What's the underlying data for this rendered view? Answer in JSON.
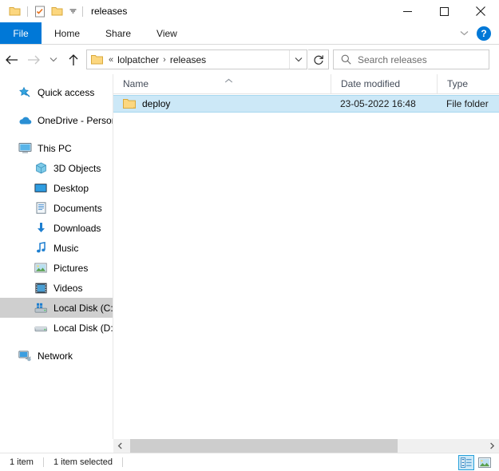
{
  "window": {
    "title": "releases",
    "quick_access_toolbar": [
      {
        "name": "pin-folder-icon",
        "tooltip": "Pin to Quick access"
      },
      {
        "name": "properties-icon",
        "tooltip": "Properties"
      },
      {
        "name": "new-folder-icon",
        "tooltip": "New folder"
      }
    ],
    "controls": {
      "minimize": "—",
      "maximize": "☐",
      "close": "✕"
    }
  },
  "ribbon": {
    "tabs": [
      {
        "label": "File",
        "active": true
      },
      {
        "label": "Home",
        "active": false
      },
      {
        "label": "Share",
        "active": false
      },
      {
        "label": "View",
        "active": false
      }
    ],
    "collapse_label": "∨",
    "help_label": "?"
  },
  "navigation": {
    "back_tooltip": "Back",
    "forward_tooltip": "Forward",
    "recent_tooltip": "Recent locations",
    "up_tooltip": "Up",
    "refresh_tooltip": "Refresh",
    "breadcrumb": {
      "overflow": "«",
      "items": [
        "lolpatcher",
        "releases"
      ],
      "separator": "›"
    }
  },
  "search": {
    "placeholder": "Search releases",
    "value": ""
  },
  "sidebar": {
    "items": [
      {
        "label": "Quick access",
        "icon": "star-pin-icon",
        "indent": 0,
        "selected": false,
        "gap_before": false
      },
      {
        "label": "OneDrive - Person",
        "icon": "cloud-icon",
        "indent": 0,
        "selected": false,
        "gap_before": true
      },
      {
        "label": "This PC",
        "icon": "monitor-icon",
        "indent": 0,
        "selected": false,
        "gap_before": true
      },
      {
        "label": "3D Objects",
        "icon": "cube-icon",
        "indent": 1,
        "selected": false,
        "gap_before": false
      },
      {
        "label": "Desktop",
        "icon": "desktop-icon",
        "indent": 1,
        "selected": false,
        "gap_before": false
      },
      {
        "label": "Documents",
        "icon": "documents-icon",
        "indent": 1,
        "selected": false,
        "gap_before": false
      },
      {
        "label": "Downloads",
        "icon": "downloads-arrow-icon",
        "indent": 1,
        "selected": false,
        "gap_before": false
      },
      {
        "label": "Music",
        "icon": "music-note-icon",
        "indent": 1,
        "selected": false,
        "gap_before": false
      },
      {
        "label": "Pictures",
        "icon": "pictures-icon",
        "indent": 1,
        "selected": false,
        "gap_before": false
      },
      {
        "label": "Videos",
        "icon": "videos-icon",
        "indent": 1,
        "selected": false,
        "gap_before": false
      },
      {
        "label": "Local Disk (C:)",
        "icon": "system-drive-icon",
        "indent": 1,
        "selected": true,
        "gap_before": false
      },
      {
        "label": "Local Disk (D:)",
        "icon": "drive-icon",
        "indent": 1,
        "selected": false,
        "gap_before": false
      },
      {
        "label": "Network",
        "icon": "network-icon",
        "indent": 0,
        "selected": false,
        "gap_before": true
      }
    ]
  },
  "file_list": {
    "columns": [
      {
        "label": "Name",
        "sorted": true,
        "sort_direction": "asc"
      },
      {
        "label": "Date modified",
        "sorted": false
      },
      {
        "label": "Type",
        "sorted": false
      }
    ],
    "rows": [
      {
        "name": "deploy",
        "date_modified": "23-05-2022 16:48",
        "type": "File folder",
        "icon": "folder-icon",
        "selected": true
      }
    ]
  },
  "status_bar": {
    "item_count": "1 item",
    "selection_count": "1 item selected",
    "views": [
      {
        "name": "details-view",
        "active": true
      },
      {
        "name": "large-icons-view",
        "active": false
      }
    ]
  },
  "colors": {
    "accent": "#0078d7",
    "selection_fill": "#cce8f7",
    "selection_border": "#a8d8ef",
    "folder_yellow": "#fcd77f",
    "sidebar_selected": "#cfcfcf"
  }
}
